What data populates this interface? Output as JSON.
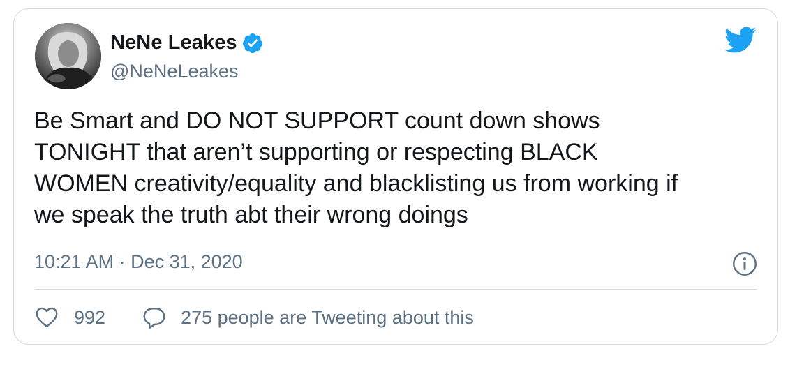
{
  "author": {
    "name": "NeNe Leakes",
    "handle": "@NeNeLeakes",
    "verified": true,
    "avatar_icon": "profile-photo"
  },
  "tweet": {
    "text": "Be Smart and DO NOT SUPPORT count down shows\nTONIGHT that aren’t supporting or respecting BLACK\nWOMEN creativity/equality and blacklisting us from working if\nwe speak the truth abt their wrong doings",
    "timestamp": "10:21 AM · Dec 31, 2020"
  },
  "stats": {
    "likes": "992",
    "tweeting_about": "275 people are Tweeting about this"
  },
  "icons": {
    "brand": "twitter-bird-icon",
    "verified": "verified-badge-icon",
    "info": "info-icon",
    "like": "heart-icon",
    "reply": "speech-bubble-icon"
  },
  "colors": {
    "brand": "#1da1f2",
    "text": "#14171a",
    "muted": "#5b7083",
    "border": "#cfd9de"
  }
}
